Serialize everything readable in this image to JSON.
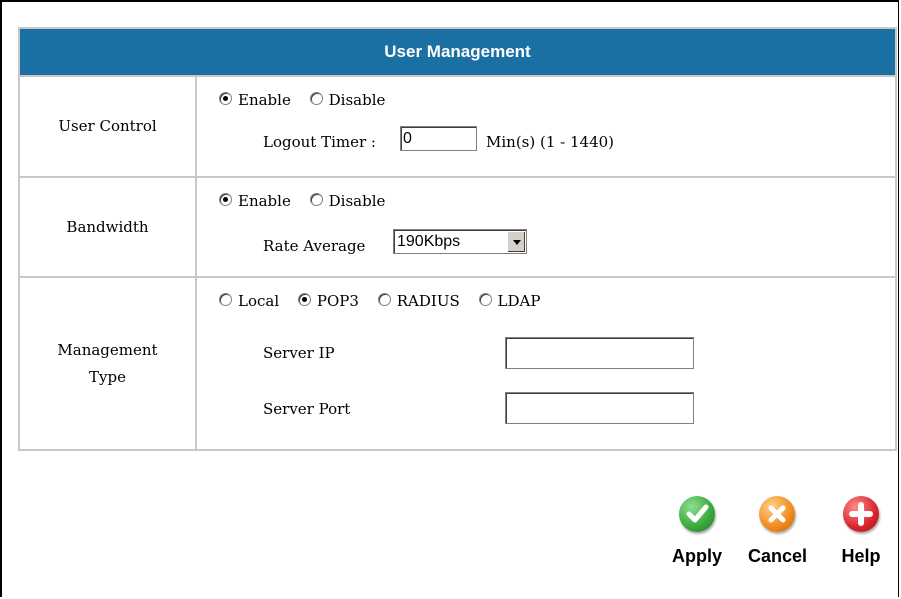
{
  "page_title": "User Management",
  "user_control": {
    "label": "User Control",
    "enable_label": "Enable",
    "disable_label": "Disable",
    "selected": "Enable",
    "logout_timer_label": "Logout Timer :",
    "logout_timer_value": "0",
    "logout_timer_hint": "Min(s) (1 - 1440)"
  },
  "bandwidth": {
    "label": "Bandwidth",
    "enable_label": "Enable",
    "disable_label": "Disable",
    "selected": "Enable",
    "rate_label": "Rate Average",
    "rate_value": "190Kbps"
  },
  "management_type": {
    "label_line1": "Management",
    "label_line2": "Type",
    "options": [
      "Local",
      "POP3",
      "RADIUS",
      "LDAP"
    ],
    "selected": "POP3",
    "server_ip_label": "Server IP",
    "server_ip_value": "",
    "server_port_label": "Server Port",
    "server_port_value": ""
  },
  "buttons": {
    "apply": "Apply",
    "cancel": "Cancel",
    "help": "Help"
  },
  "colors": {
    "header_bg": "#1a6fa3",
    "apply_green": "#3aa63a",
    "cancel_orange": "#f08a1c",
    "help_red": "#d8232a"
  }
}
